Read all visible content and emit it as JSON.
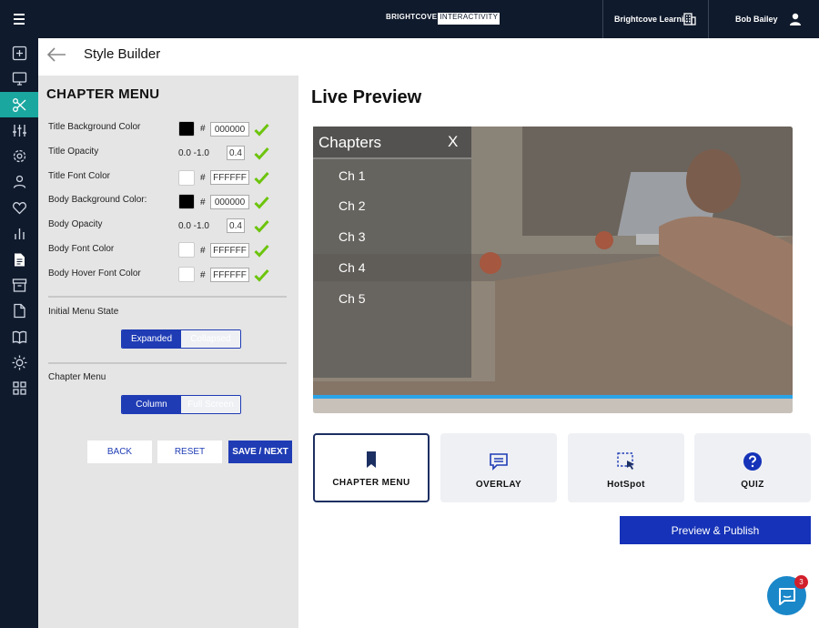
{
  "topbar": {
    "logo_left": "BRIGHTCOVE",
    "logo_right": "INTERACTIVITY",
    "org_name": "Brightcove Learni...",
    "user_name": "Bob Bailey"
  },
  "nav": {
    "items": [
      "add-icon",
      "monitor-icon",
      "scissors-icon",
      "sliders-icon",
      "gear-icon",
      "user-icon",
      "heart-icon",
      "bar-chart-icon",
      "document-icon",
      "archive-icon",
      "file-icon",
      "book-icon",
      "sun-icon",
      "grid-icon"
    ],
    "active": "scissors-icon"
  },
  "header": {
    "title": "Style Builder"
  },
  "panel": {
    "title": "CHAPTER MENU",
    "rows": [
      {
        "label": "Title Background Color",
        "kind": "color",
        "swatch": "#000000",
        "value": "000000"
      },
      {
        "label": "Title Opacity",
        "kind": "opacity",
        "range": "0.0 -1.0",
        "value": "0.4"
      },
      {
        "label": "Title Font Color",
        "kind": "color",
        "swatch": "#ffffff",
        "value": "FFFFFF"
      },
      {
        "label": "Body Background Color:",
        "kind": "color",
        "swatch": "#000000",
        "value": "000000"
      },
      {
        "label": "Body Opacity",
        "kind": "opacity",
        "range": "0.0 -1.0",
        "value": "0.4"
      },
      {
        "label": "Body Font Color",
        "kind": "color",
        "swatch": "#ffffff",
        "value": "FFFFFF"
      },
      {
        "label": "Body Hover Font Color",
        "kind": "color",
        "swatch": "#ffffff",
        "value": "FFFFFF"
      }
    ],
    "hash": "#",
    "initial_state": {
      "label": "Initial Menu State",
      "options": [
        "Expanded",
        "Collapsed"
      ],
      "selected": "Expanded"
    },
    "chapter_menu": {
      "label": "Chapter Menu",
      "options": [
        "Column",
        "Full Screen"
      ],
      "selected": "Column"
    },
    "buttons": {
      "back": "BACK",
      "reset": "RESET",
      "save": "SAVE / NEXT"
    }
  },
  "preview": {
    "title": "Live Preview",
    "menu_title": "Chapters",
    "menu_close": "X",
    "chapters": [
      "Ch 1",
      "Ch 2",
      "Ch 3",
      "Ch 4",
      "Ch 5"
    ]
  },
  "cards": [
    {
      "label": "CHAPTER MENU",
      "icon": "bookmark-icon",
      "selected": true
    },
    {
      "label": "OVERLAY",
      "icon": "overlay-icon",
      "selected": false
    },
    {
      "label": "HotSpot",
      "icon": "hotspot-icon",
      "selected": false
    },
    {
      "label": "QUIZ",
      "icon": "quiz-icon",
      "selected": false
    }
  ],
  "publish_label": "Preview & Publish",
  "chat": {
    "badge": "3"
  },
  "colors": {
    "nav_bg": "#0f1a2c",
    "accent": "#1f3cb5",
    "active_nav": "#19a7a0",
    "check": "#6cc40c"
  }
}
